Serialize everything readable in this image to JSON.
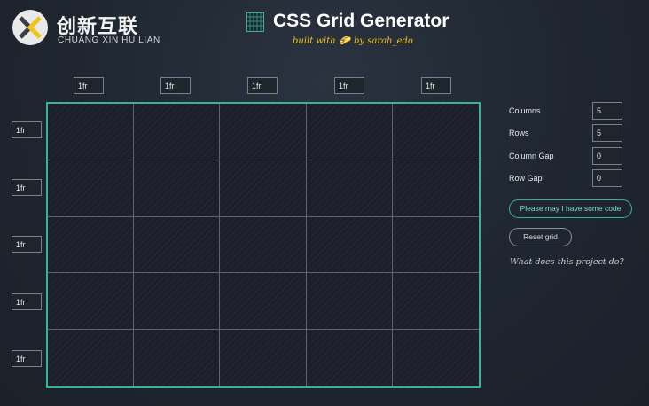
{
  "watermark": {
    "cn_text": "创新互联",
    "en_text": "CHUANG XIN HU LIAN"
  },
  "header": {
    "title": "CSS Grid Generator",
    "subtitle_prefix": "built with",
    "subtitle_icon": "taco-icon",
    "subtitle_suffix": "by sarah_edo",
    "title_icon": "grid-icon"
  },
  "column_units": [
    "1fr",
    "1fr",
    "1fr",
    "1fr",
    "1fr"
  ],
  "row_units": [
    "1fr",
    "1fr",
    "1fr",
    "1fr",
    "1fr"
  ],
  "controls": {
    "columns": {
      "label": "Columns",
      "value": "5"
    },
    "rows": {
      "label": "Rows",
      "value": "5"
    },
    "column_gap": {
      "label": "Column Gap",
      "value": "0"
    },
    "row_gap": {
      "label": "Row Gap",
      "value": "0"
    }
  },
  "buttons": {
    "code": "Please may I have some code",
    "reset": "Reset grid"
  },
  "about_link": "What does this project do?",
  "colors": {
    "background": "#1f2630",
    "accent": "#35b596",
    "subtitle": "#f0c419",
    "grid_lines": "#5d6470"
  }
}
